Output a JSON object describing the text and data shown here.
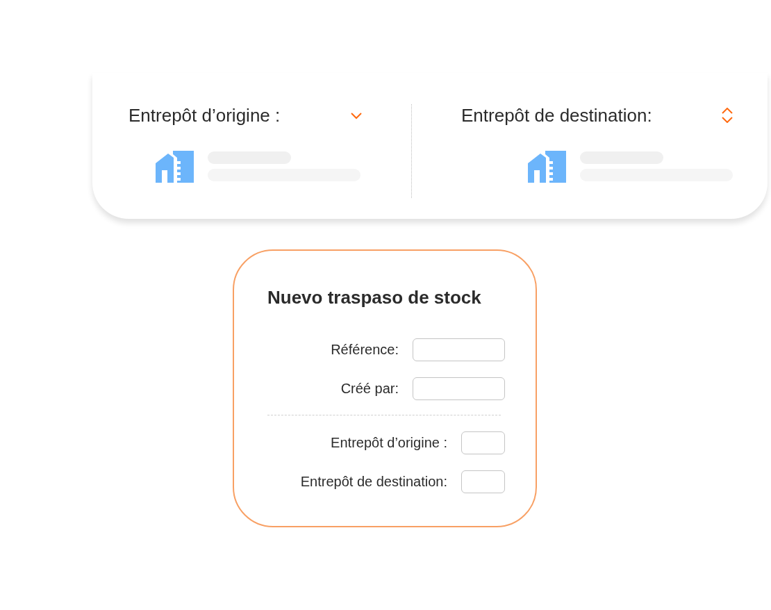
{
  "warehouses": [
    {
      "title": "Entrepôt d’origine :",
      "kind": "dropdown"
    },
    {
      "title": "Entrepôt de destination:",
      "kind": "sorter"
    }
  ],
  "form": {
    "title": "Nuevo traspaso de stock",
    "sections": [
      [
        {
          "label": "Référence:"
        },
        {
          "label": "Créé par:"
        }
      ],
      [
        {
          "label": "Entrepôt d’origine :"
        },
        {
          "label": "Entrepôt de destination:"
        }
      ]
    ]
  }
}
